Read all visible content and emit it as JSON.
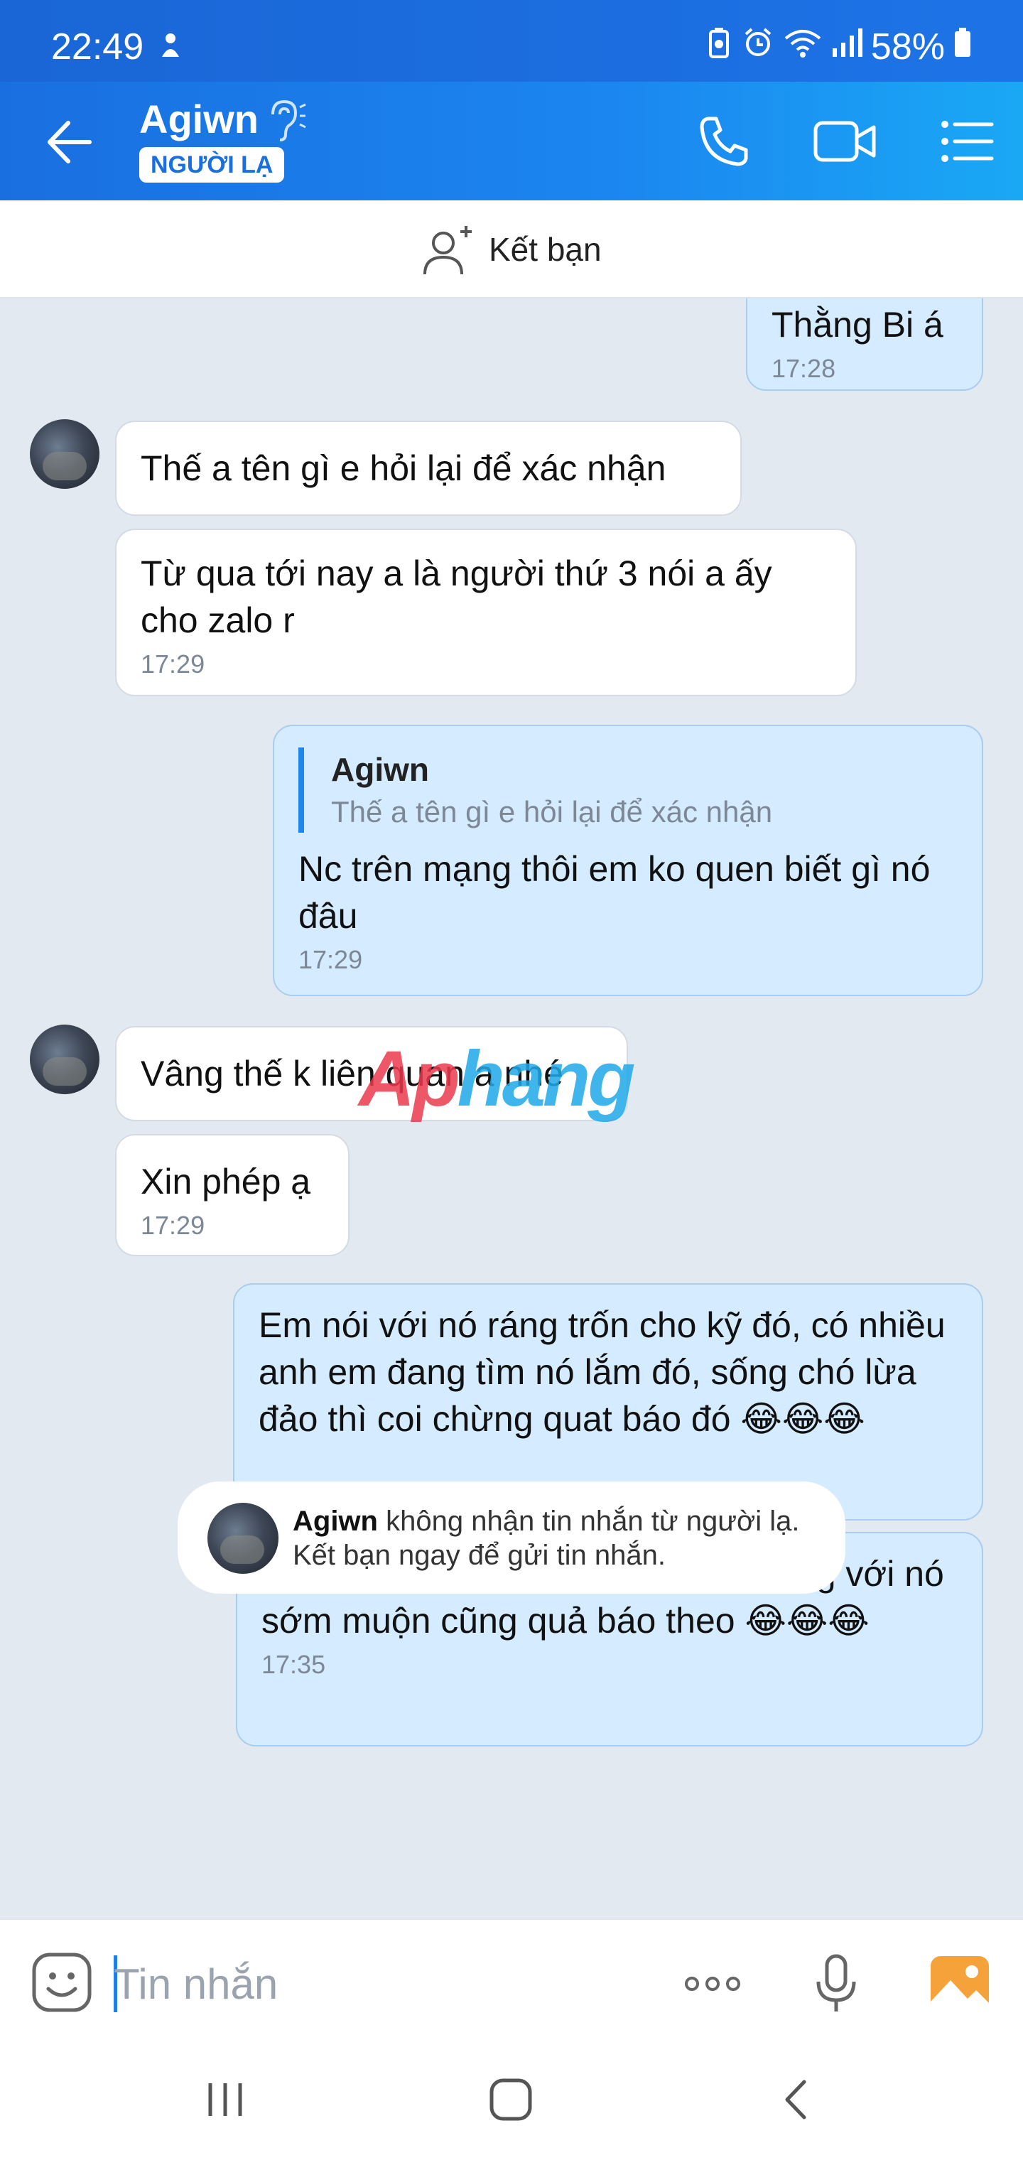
{
  "status_bar": {
    "time": "22:49",
    "battery": "58%"
  },
  "header": {
    "contact_name": "Agiwn",
    "badge": "NGƯỜI LẠ"
  },
  "add_friend": {
    "label": "Kết bạn"
  },
  "messages": [
    {
      "text": "Thằng Bi á",
      "time": "17:28"
    },
    {
      "text": "Thế a tên gì e hỏi lại để xác nhận"
    },
    {
      "text": "Từ qua tới nay a là người thứ 3 nói a ấy cho zalo r",
      "time": "17:29"
    },
    {
      "quote_name": "Agiwn",
      "quote_text": "Thế a tên gì e hỏi lại để xác nhận",
      "text": "Nc trên mạng thôi em ko quen biết gì nó đâu",
      "time": "17:29"
    },
    {
      "text": "Vâng thế k liên quan a nhé"
    },
    {
      "text": "Xin phép ạ",
      "time": "17:29"
    },
    {
      "text": "Em nói với nó ráng trốn cho kỹ đó, có nhiều anh em đang tìm nó lắm đó, sống chó lừa đảo thì coi chừng quat báo đó 😂😂😂"
    },
    {
      "text": "Còn em nữa, hợp tác lừa đảo chung với nó sớm muộn cũng quả báo theo 😂😂😂",
      "time": "17:35"
    }
  ],
  "system_note": {
    "name": "Agiwn",
    "line1": "không nhận tin nhắn từ người lạ.",
    "line2": "Kết bạn ngay để gửi tin nhắn."
  },
  "watermark": {
    "part1": "Ap",
    "part2": "hang"
  },
  "composer": {
    "placeholder": "Tin nhắn"
  },
  "colors": {
    "accent": "#1a6fe0",
    "outgoing_bubble": "#d5ebff",
    "incoming_bubble": "#ffffff",
    "chat_bg": "#e2e9f1"
  },
  "icons": [
    "back-arrow-icon",
    "ear-icon",
    "phone-icon",
    "video-call-icon",
    "menu-list-icon",
    "add-friend-icon",
    "emoji-icon",
    "more-dots-icon",
    "microphone-icon",
    "image-icon"
  ]
}
